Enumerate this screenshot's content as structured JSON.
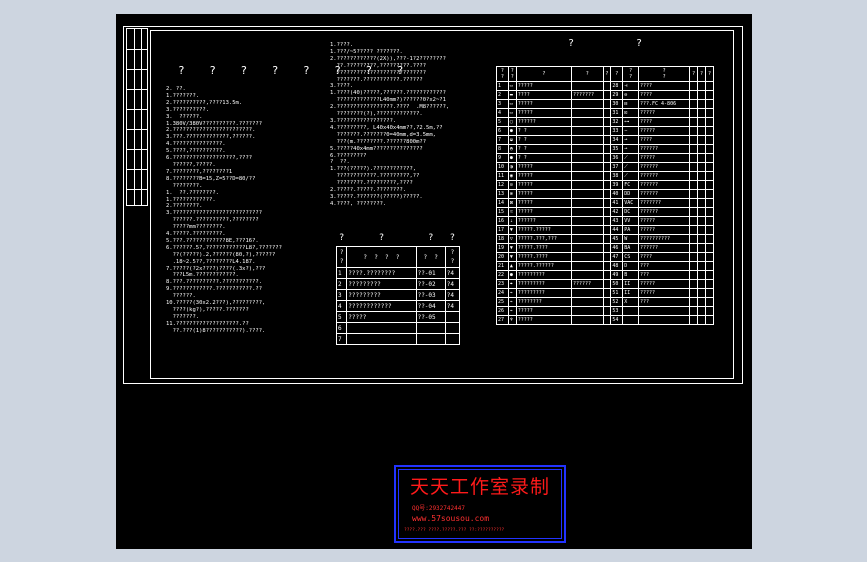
{
  "drawing": {
    "title": "? ? ? ? ? ? ? ?",
    "notes_left": [
      "2. ??.",
      "1.???????.",
      "2.??????????,????13.5m.",
      "3.??????????.",
      "3.  ??????.",
      "1.380V/380V??????????.???????",
      "2.????????????????????????.",
      "3.???.?????????????,??????.",
      "4.???????????????.",
      "5.????,??????????.",
      "6.???????????????????,????",
      "  ??????,?????.",
      "7.????????,????????1",
      "8.????????B=15,Z=5??D=80/??",
      "  ????????.",
      "1.  ??.????????.",
      "1.????????????.",
      "2.????????.",
      "3.???????????????????????????",
      "  ??????.??????????,????????",
      "  ?????mm????????.",
      "4.?????.?????????.",
      "5.???.????????????8E,???16?.",
      "6.??????.5?,????????????L8?,???????",
      "  ??(?????).2,??????(80,?),??????",
      "  .18~2.5??,????????L4.187.",
      "7.?????(?2x????)????(.3x?),???",
      "  ???L5m.????????????.",
      "8.???.??????????.???????????.",
      "9.????????????.???????????.??",
      "  ??????.",
      "10.?????(30x2.2???),?????????,",
      "  ????(kg?),?????.???????",
      "  ???????.",
      "11.???????????????????.??",
      "  ??.???(1)8???????????).????."
    ],
    "notes_mid": [
      "1.????.",
      "1.???/~5????? ???????.",
      "2.????????????(2X)),???-1?2????????",
      "  ??.?????????,?????????.????",
      "  ???????????????????????????",
      "  ???????.???????????.??????",
      "3.????.",
      "1.????(40)?????,??????.????????????",
      "  ?????????????L40mm?)??????0?x2~?1",
      "2.?????????????????.????  .M8??????,",
      "  ????????(?),?????????????.",
      "3.?????????????????.",
      "4.?????????, L40x40x4mm??,?2.5m,??",
      "  ???????.???????0=40mm,d=3.5mm,",
      "  ???(m.????????.??????800m??",
      "5.?????40x4mm???????????????",
      "6.?????????",
      "?  ??.",
      "1.???(?????).????????????,",
      "  ????????????.?????????,??",
      "  ????????.?????????,????",
      "2.?????.?????.????????.",
      "3.?????.???????(?????)?????.",
      "4.????, ????????."
    ],
    "header_right_1": "?",
    "header_right_2": "?"
  },
  "small_table": {
    "header": [
      "?",
      "?",
      "?",
      "?"
    ],
    "col_headers": [
      "?\n?",
      "?  ?  ?  ?",
      "?  ?",
      "?\n?"
    ],
    "rows": [
      [
        "1",
        "????.????????",
        "??-01",
        "?4"
      ],
      [
        "2",
        "?????????",
        "??-02",
        "?4"
      ],
      [
        "3",
        "?????????",
        "??-03",
        "?4"
      ],
      [
        "4",
        "????????????",
        "??-04",
        "?4"
      ],
      [
        "5",
        "?????",
        "??-05",
        ""
      ],
      [
        "6",
        "",
        "",
        ""
      ],
      [
        "7",
        "",
        "",
        ""
      ]
    ]
  },
  "legend_table": {
    "headers": [
      "?\n?",
      "?\n?",
      "?",
      "?",
      "?",
      "?",
      "?\n?",
      "?\n?",
      "?",
      "?",
      "?"
    ],
    "left_rows": [
      [
        "1",
        "▭",
        "?????",
        "",
        ""
      ],
      [
        "2",
        "▬",
        "????",
        "???????",
        ""
      ],
      [
        "3",
        "▭",
        "?????",
        "",
        ""
      ],
      [
        "4",
        "▭",
        "?????",
        "",
        ""
      ],
      [
        "5",
        "▢",
        "??????",
        "",
        ""
      ],
      [
        "6",
        "●",
        "? ?",
        "",
        ""
      ],
      [
        "7",
        "◒",
        "? ?",
        "",
        ""
      ],
      [
        "8",
        "◓",
        "? ?",
        "",
        ""
      ],
      [
        "9",
        "●",
        "? ?",
        "",
        ""
      ],
      [
        "10",
        "◑",
        "?????",
        "",
        ""
      ],
      [
        "11",
        "◉",
        "?????",
        "",
        ""
      ],
      [
        "12",
        "⊙",
        "?????",
        "",
        ""
      ],
      [
        "13",
        "⊗",
        "?????",
        "",
        ""
      ],
      [
        "14",
        "⊠",
        "?????",
        "",
        ""
      ],
      [
        "15",
        "≂",
        "?????",
        "",
        ""
      ],
      [
        "16",
        "⇣",
        "??????",
        "",
        ""
      ],
      [
        "17",
        "▼",
        "?????.?????",
        "",
        ""
      ],
      [
        "18",
        "▽",
        "?????.???,???",
        "",
        ""
      ],
      [
        "19",
        "▼",
        "?????.????",
        "",
        ""
      ],
      [
        "20",
        "▼",
        "?????.????",
        "",
        ""
      ],
      [
        "21",
        "▲",
        "?????.??????",
        "",
        ""
      ],
      [
        "22",
        "●",
        "?????????",
        "",
        ""
      ],
      [
        "23",
        "⌖",
        "?????????",
        "??????",
        ""
      ],
      [
        "24",
        "⌁",
        "?????????",
        "",
        ""
      ],
      [
        "25",
        "⌁",
        "????????",
        "",
        ""
      ],
      [
        "26",
        "⌁",
        "?????",
        "",
        ""
      ],
      [
        "27",
        "♆",
        "?????",
        "",
        ""
      ]
    ],
    "right_rows": [
      [
        "28",
        "⊣",
        "????",
        ""
      ],
      [
        "29",
        "⊖",
        "????",
        ""
      ],
      [
        "30",
        "⊟",
        "???.FC 4-806",
        ""
      ],
      [
        "31",
        "⊡",
        "?????",
        ""
      ],
      [
        "32",
        "⊶",
        "????",
        ""
      ],
      [
        "33",
        "∽",
        "?????",
        ""
      ],
      [
        "34",
        "⊸",
        "????",
        ""
      ],
      [
        "35",
        "⊸",
        "??????",
        ""
      ],
      [
        "36",
        "⟋",
        "?????",
        ""
      ],
      [
        "37",
        "⟋",
        "??????",
        ""
      ],
      [
        "38",
        "⟋",
        "??????",
        ""
      ],
      [
        "39",
        "FC",
        "??????",
        ""
      ],
      [
        "40",
        "DD",
        "??????",
        ""
      ],
      [
        "41",
        "VAC",
        "???????",
        ""
      ],
      [
        "42",
        "DC",
        "??????",
        ""
      ],
      [
        "43",
        "VV",
        "?????",
        ""
      ],
      [
        "44",
        "PA",
        "?????",
        ""
      ],
      [
        "45",
        "W",
        "??????????",
        ""
      ],
      [
        "46",
        "BA",
        "??????",
        ""
      ],
      [
        "47",
        "CS",
        "????",
        ""
      ],
      [
        "48",
        "D",
        "???",
        ""
      ],
      [
        "49",
        "B",
        "???",
        ""
      ],
      [
        "50",
        "II",
        "?????",
        ""
      ],
      [
        "51",
        "II",
        "?????",
        ""
      ],
      [
        "52",
        "X",
        "???",
        ""
      ],
      [
        "53",
        "",
        "",
        ""
      ],
      [
        "54",
        "",
        "",
        ""
      ]
    ]
  },
  "stamp": {
    "title": "天天工作室录制",
    "qq": "QQ号:2932742447",
    "url": "www.57sousou.com",
    "footer": "????.???  ????.?????.???  ??:??????????"
  },
  "colors": {
    "page_bg": "#cdd5e0",
    "canvas_bg": "#000000",
    "lines": "#ffffff",
    "stamp_border": "#2233ff",
    "stamp_text": "#ff1a1a"
  }
}
